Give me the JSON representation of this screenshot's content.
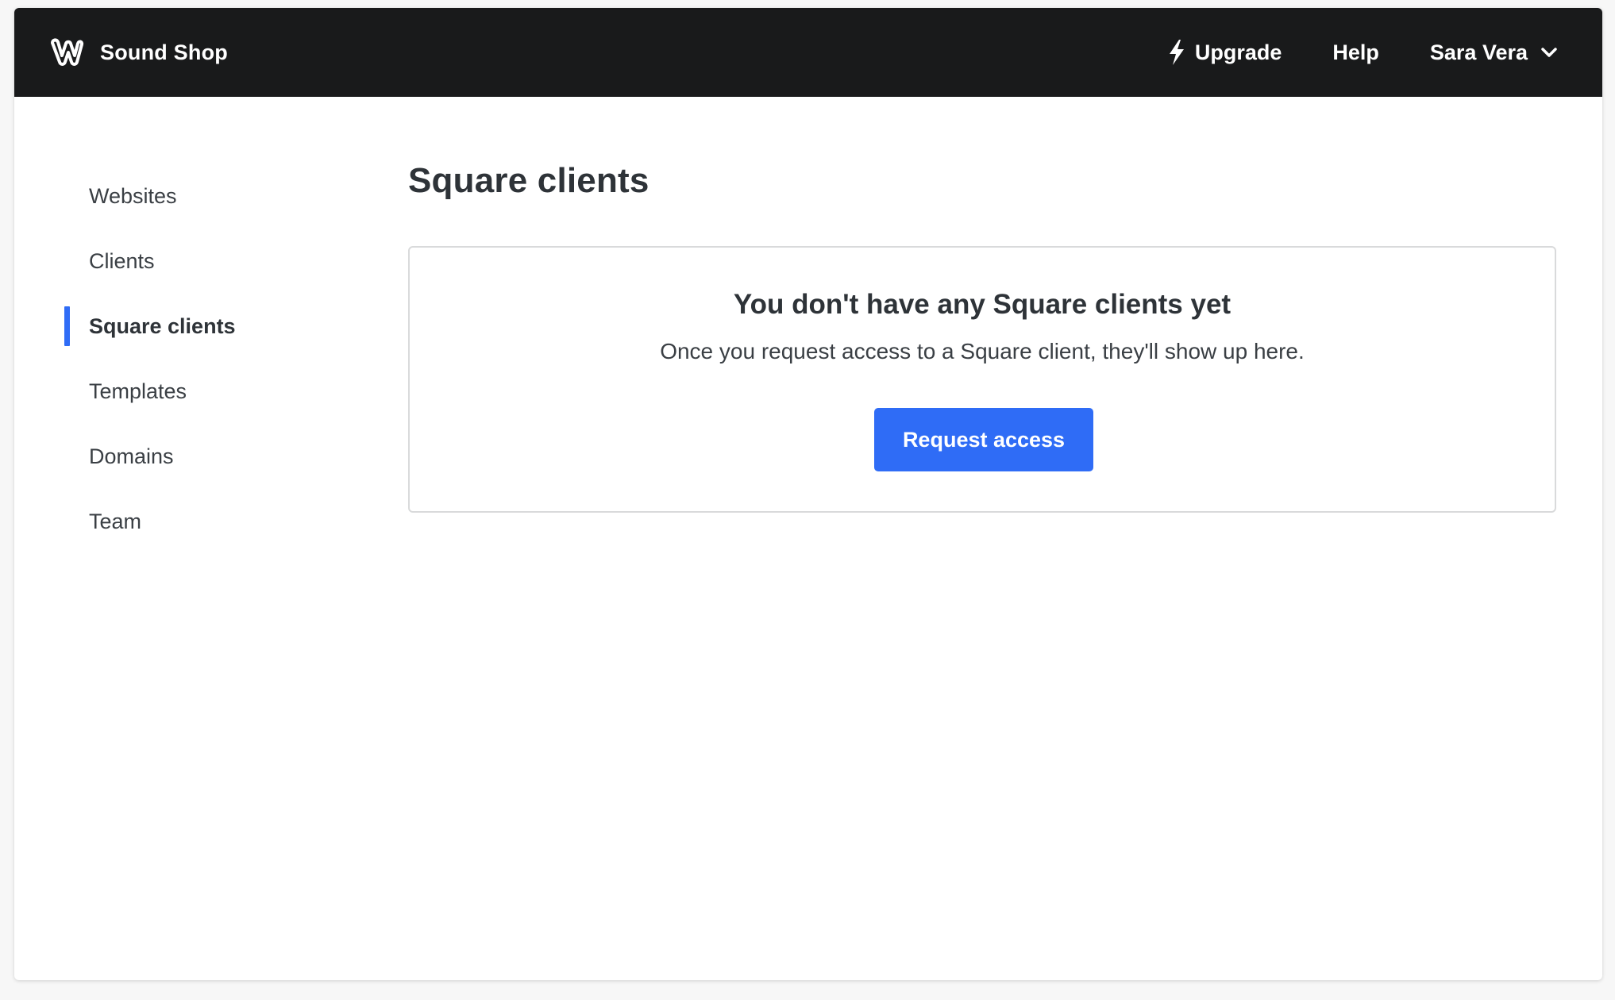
{
  "header": {
    "site_name": "Sound Shop",
    "logo_icon": "weebly-w-logo",
    "nav": {
      "upgrade_label": "Upgrade",
      "upgrade_icon": "lightning-bolt-icon",
      "help_label": "Help",
      "user_name": "Sara Vera",
      "user_menu_icon": "chevron-down-icon"
    }
  },
  "sidebar": {
    "items": [
      {
        "label": "Websites",
        "active": false
      },
      {
        "label": "Clients",
        "active": false
      },
      {
        "label": "Square clients",
        "active": true
      },
      {
        "label": "Templates",
        "active": false
      },
      {
        "label": "Domains",
        "active": false
      },
      {
        "label": "Team",
        "active": false
      }
    ]
  },
  "main": {
    "title": "Square clients",
    "empty_state": {
      "heading": "You don't have any Square clients yet",
      "description": "Once you request access to a Square client, they'll show up here.",
      "button_label": "Request access"
    }
  },
  "colors": {
    "topbar_bg": "#191a1b",
    "accent": "#2f6cf6",
    "text": "#2e3338"
  }
}
